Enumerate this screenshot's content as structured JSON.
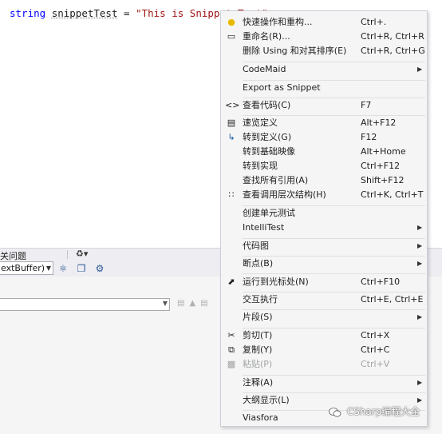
{
  "editor": {
    "code": {
      "keyword": "string",
      "identifier": "snippetTest",
      "operator": "=",
      "string_literal": "\"This is Snippet Text\""
    }
  },
  "panel": {
    "tab_label": "关问题",
    "combo_value": "extBuffer)"
  },
  "context_menu": {
    "items": [
      {
        "id": "quick-actions",
        "label": "快速操作和重构...",
        "shortcut": "Ctrl+.",
        "icon": "lightbulb-icon",
        "submenu": false,
        "enabled": true
      },
      {
        "id": "rename",
        "label": "重命名(R)...",
        "shortcut": "Ctrl+R, Ctrl+R",
        "icon": "rename-icon",
        "submenu": false,
        "enabled": true
      },
      {
        "id": "remove-sort-usings",
        "label": "删除 Using 和对其排序(E)",
        "shortcut": "Ctrl+R, Ctrl+G",
        "icon": "",
        "submenu": false,
        "enabled": true
      },
      {
        "id": "codemaid",
        "label": "CodeMaid",
        "shortcut": "",
        "icon": "",
        "submenu": true,
        "enabled": true
      },
      {
        "id": "export-snippet",
        "label": "Export as Snippet",
        "shortcut": "",
        "icon": "",
        "submenu": false,
        "enabled": true
      },
      {
        "id": "view-code",
        "label": "查看代码(C)",
        "shortcut": "F7",
        "icon": "code-icon",
        "submenu": false,
        "enabled": true
      },
      {
        "id": "peek-definition",
        "label": "速览定义",
        "shortcut": "Alt+F12",
        "icon": "peek-icon",
        "submenu": false,
        "enabled": true
      },
      {
        "id": "go-to-definition",
        "label": "转到定义(G)",
        "shortcut": "F12",
        "icon": "goto-definition-icon",
        "submenu": false,
        "enabled": true
      },
      {
        "id": "go-to-base",
        "label": "转到基础映像",
        "shortcut": "Alt+Home",
        "icon": "",
        "submenu": false,
        "enabled": true
      },
      {
        "id": "go-to-impl",
        "label": "转到实现",
        "shortcut": "Ctrl+F12",
        "icon": "",
        "submenu": false,
        "enabled": true
      },
      {
        "id": "find-all-refs",
        "label": "查找所有引用(A)",
        "shortcut": "Shift+F12",
        "icon": "",
        "submenu": false,
        "enabled": true
      },
      {
        "id": "call-hierarchy",
        "label": "查看调用层次结构(H)",
        "shortcut": "Ctrl+K, Ctrl+T",
        "icon": "call-hierarchy-icon",
        "submenu": false,
        "enabled": true
      },
      {
        "id": "create-unit-tests",
        "label": "创建单元测试",
        "shortcut": "",
        "icon": "",
        "submenu": false,
        "enabled": true
      },
      {
        "id": "intellitest",
        "label": "IntelliTest",
        "shortcut": "",
        "icon": "",
        "submenu": true,
        "enabled": true
      },
      {
        "id": "code-map",
        "label": "代码图",
        "shortcut": "",
        "icon": "",
        "submenu": true,
        "enabled": true
      },
      {
        "id": "breakpoint",
        "label": "断点(B)",
        "shortcut": "",
        "icon": "",
        "submenu": true,
        "enabled": true
      },
      {
        "id": "run-to-cursor",
        "label": "运行到光标处(N)",
        "shortcut": "Ctrl+F10",
        "icon": "cursor-icon",
        "submenu": false,
        "enabled": true
      },
      {
        "id": "interactive",
        "label": "交互执行",
        "shortcut": "Ctrl+E, Ctrl+E",
        "icon": "",
        "submenu": false,
        "enabled": true
      },
      {
        "id": "snippet",
        "label": "片段(S)",
        "shortcut": "",
        "icon": "",
        "submenu": true,
        "enabled": true
      },
      {
        "id": "cut",
        "label": "剪切(T)",
        "shortcut": "Ctrl+X",
        "icon": "scissors-icon",
        "submenu": false,
        "enabled": true
      },
      {
        "id": "copy",
        "label": "复制(Y)",
        "shortcut": "Ctrl+C",
        "icon": "copy-icon",
        "submenu": false,
        "enabled": true
      },
      {
        "id": "paste",
        "label": "粘贴(P)",
        "shortcut": "Ctrl+V",
        "icon": "paste-icon",
        "submenu": false,
        "enabled": false
      },
      {
        "id": "comment",
        "label": "注释(A)",
        "shortcut": "",
        "icon": "",
        "submenu": true,
        "enabled": true
      },
      {
        "id": "outlining",
        "label": "大纲显示(L)",
        "shortcut": "",
        "icon": "",
        "submenu": true,
        "enabled": true
      },
      {
        "id": "viasfora",
        "label": "Viasfora",
        "shortcut": "",
        "icon": "",
        "submenu": false,
        "enabled": true
      }
    ]
  },
  "watermark": {
    "text": "CSharp编程大全"
  },
  "colors": {
    "keyword": "#0000ff",
    "string": "#a31515",
    "menu_background": "#f5f5f5",
    "disabled_text": "#a2a4a5"
  }
}
